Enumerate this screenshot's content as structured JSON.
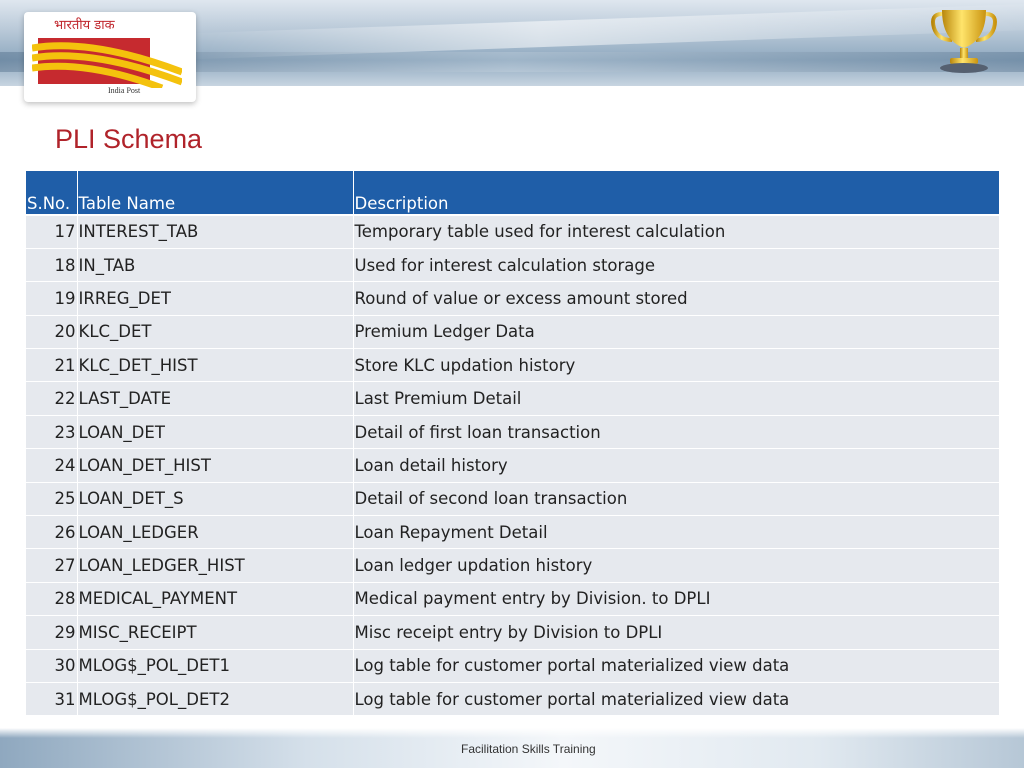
{
  "header": {
    "logo_hindi": "भारतीय डाक",
    "logo_english": "India Post"
  },
  "slide": {
    "title": "PLI Schema"
  },
  "table": {
    "columns": [
      "S.No.",
      "Table Name",
      "Description"
    ],
    "rows": [
      {
        "sno": "17",
        "name": "INTEREST_TAB",
        "desc": "Temporary table used for interest calculation"
      },
      {
        "sno": "18",
        "name": "IN_TAB",
        "desc": "Used for interest calculation storage"
      },
      {
        "sno": "19",
        "name": "IRREG_DET",
        "desc": "Round of value or excess amount stored"
      },
      {
        "sno": "20",
        "name": "KLC_DET",
        "desc": "Premium Ledger Data"
      },
      {
        "sno": "21",
        "name": "KLC_DET_HIST",
        "desc": "Store KLC updation history"
      },
      {
        "sno": "22",
        "name": "LAST_DATE",
        "desc": "Last Premium Detail"
      },
      {
        "sno": "23",
        "name": "LOAN_DET",
        "desc": "Detail of first loan transaction"
      },
      {
        "sno": "24",
        "name": "LOAN_DET_HIST",
        "desc": "Loan detail history"
      },
      {
        "sno": "25",
        "name": "LOAN_DET_S",
        "desc": "Detail of second loan transaction"
      },
      {
        "sno": "26",
        "name": "LOAN_LEDGER",
        "desc": "Loan Repayment Detail"
      },
      {
        "sno": "27",
        "name": "LOAN_LEDGER_HIST",
        "desc": "Loan ledger updation history"
      },
      {
        "sno": "28",
        "name": "MEDICAL_PAYMENT",
        "desc": "Medical payment entry by Division. to DPLI"
      },
      {
        "sno": "29",
        "name": "MISC_RECEIPT",
        "desc": "Misc receipt entry by Division to DPLI"
      },
      {
        "sno": "30",
        "name": "MLOG$_POL_DET1",
        "desc": "Log table for customer portal materialized view data"
      },
      {
        "sno": "31",
        "name": "MLOG$_POL_DET2",
        "desc": "Log table for customer portal materialized view data"
      }
    ]
  },
  "footer": {
    "text": "Facilitation Skills Training"
  },
  "icons": {
    "logo": "india-post-logo",
    "trophy": "trophy-icon"
  },
  "colors": {
    "title": "#b0232a",
    "header_bg": "#1f5ea8",
    "row_bg": "#e6e9ee"
  }
}
